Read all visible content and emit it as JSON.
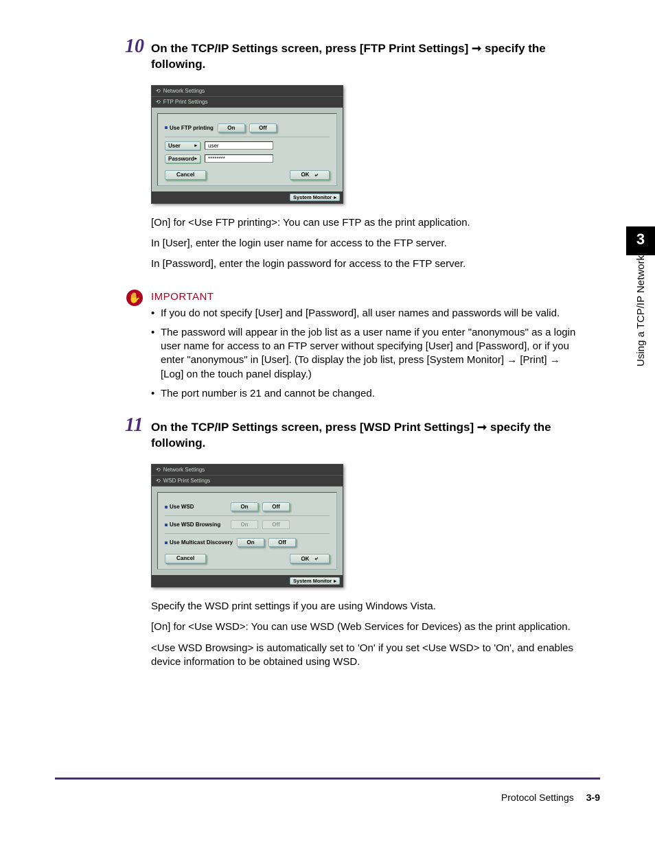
{
  "chapter": {
    "number": "3",
    "label": "Using a TCP/IP Network"
  },
  "steps": {
    "s10": {
      "num": "10",
      "title_a": "On the TCP/IP Settings screen, press [FTP Print Settings]",
      "title_b": "specify the following.",
      "p1": "[On] for <Use FTP printing>: You can use FTP as the print application.",
      "p2": "In [User], enter the login user name for access to the FTP server.",
      "p3": "In [Password], enter the login password for access to the FTP server."
    },
    "s11": {
      "num": "11",
      "title_a": "On the TCP/IP Settings screen, press [WSD Print Settings]",
      "title_b": "specify the following.",
      "p1": "Specify the WSD print settings if you are using Windows Vista.",
      "p2": "[On] for <Use WSD>: You can use WSD (Web Services for Devices) as the print application.",
      "p3": "<Use WSD Browsing> is automatically set to 'On' if you set <Use WSD> to 'On', and enables device information to be obtained using WSD."
    }
  },
  "important": {
    "title": "IMPORTANT",
    "items": [
      "If you do not specify [User] and [Password], all user names and passwords will be valid.",
      "The password will appear in the job list as a user name if you enter \"anonymous\" as a login user name for access to an FTP server without specifying [User] and [Password], or if you enter \"anonymous\" in [User]. (To display the job list, press [System Monitor] → [Print] → [Log] on the touch panel display.)",
      "The port number is 21 and cannot be changed."
    ]
  },
  "screenshots": {
    "ftp": {
      "top": "Network Settings",
      "sub": "FTP Print Settings",
      "use_label": "Use FTP printing",
      "on": "On",
      "off": "Off",
      "user_label": "User",
      "user_val": "user",
      "pass_label": "Password",
      "pass_val": "********",
      "cancel": "Cancel",
      "ok": "OK",
      "sysmon": "System Monitor"
    },
    "wsd": {
      "top": "Network Settings",
      "sub": "WSD Print Settings",
      "row1": "Use WSD",
      "row2": "Use WSD Browsing",
      "row3": "Use Multicast Discovery",
      "on": "On",
      "off": "Off",
      "cancel": "Cancel",
      "ok": "OK",
      "sysmon": "System Monitor"
    }
  },
  "footer": {
    "section": "Protocol Settings",
    "page": "3-9"
  }
}
